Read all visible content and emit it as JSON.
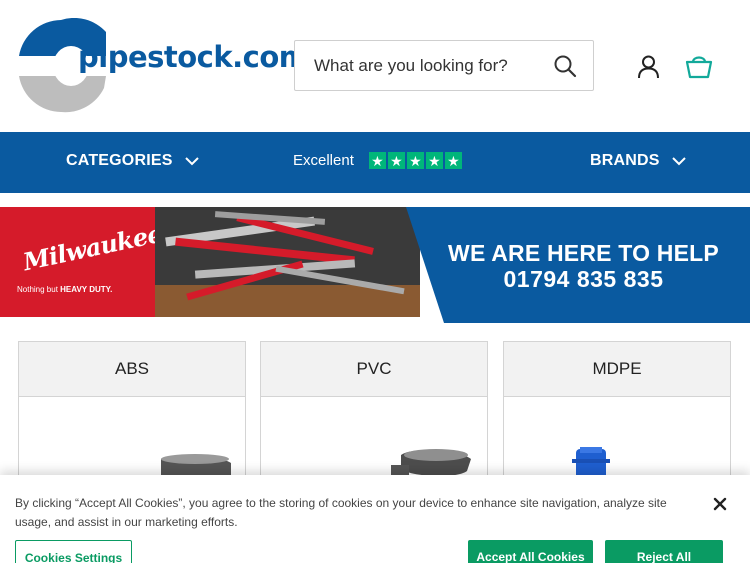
{
  "header": {
    "logo_text": "pipestock.com",
    "search_placeholder": "What are you looking for?",
    "account_icon": "user-icon",
    "basket_icon": "basket-icon",
    "brand_color": "#0a5aa0",
    "basket_color": "#12a99a"
  },
  "nav": {
    "categories_label": "CATEGORIES",
    "trust_label": "Excellent",
    "trust_rating": 5,
    "brands_label": "BRANDS",
    "nav_color": "#0a5aa0"
  },
  "banner": {
    "brand_logo": "Milwaukee",
    "brand_tagline_prefix": "Nothing but ",
    "brand_tagline_bold": "HEAVY DUTY.",
    "help_title": "WE ARE HERE TO HELP",
    "help_phone": "01794 835 835"
  },
  "categories": [
    {
      "label": "ABS"
    },
    {
      "label": "PVC"
    },
    {
      "label": "MDPE"
    }
  ],
  "cookie": {
    "text": "By clicking “Accept All Cookies”, you agree to the storing of cookies on your device to enhance site navigation, analyze site usage, and assist in our marketing efforts.",
    "settings_label": "Cookies Settings",
    "accept_label": "Accept All Cookies",
    "reject_label": "Reject All",
    "button_color": "#0a9b63"
  }
}
